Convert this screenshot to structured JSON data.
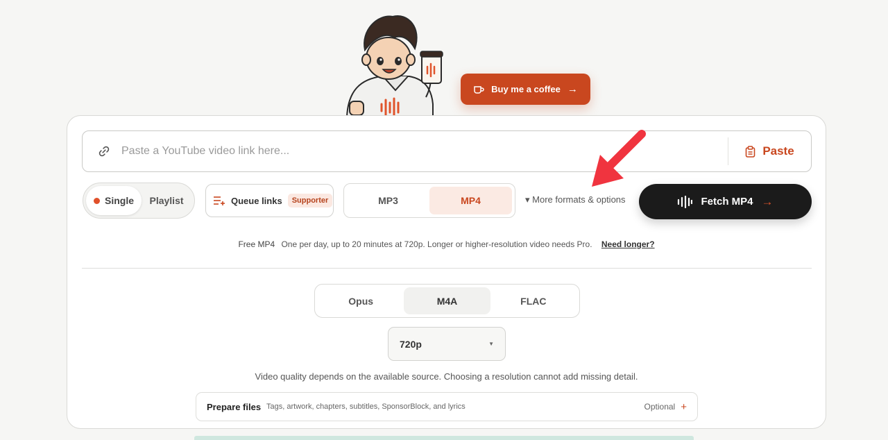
{
  "coffee_button": {
    "label": "Buy me a coffee",
    "arrow": "→",
    "icon": "coffee-cup-icon"
  },
  "url_bar": {
    "placeholder": "Paste a YouTube video link here...",
    "paste_label": "Paste"
  },
  "mode_toggle": {
    "single_label": "Single",
    "playlist_label": "Playlist",
    "selected": "Single"
  },
  "queue": {
    "label": "Queue links",
    "badge": "Supporter"
  },
  "format_toggle": {
    "mp3_label": "MP3",
    "mp4_label": "MP4",
    "selected": "MP4"
  },
  "more_formats_label": "▾ More formats & options",
  "fetch_button": {
    "label": "Fetch MP4",
    "arrow": "→"
  },
  "info": {
    "free_label": "Free MP4",
    "text": "One per day, up to 20 minutes at 720p. Longer or higher-resolution video needs Pro.",
    "need_longer": "Need longer?"
  },
  "audio_format": {
    "options": [
      "Opus",
      "M4A",
      "FLAC"
    ],
    "selected": "M4A"
  },
  "resolution": {
    "value": "720p",
    "caret": "▼"
  },
  "quality_note": "Video quality depends on the available source. Choosing a resolution cannot add missing detail.",
  "prepare_files": {
    "title": "Prepare files",
    "description": "Tags, artwork, chapters, subtitles, SponsorBlock, and lyrics",
    "optional_label": "Optional",
    "plus": "+"
  },
  "colors": {
    "accent": "#c9471f",
    "dark": "#1b1b1b",
    "annotation": "#f0343f"
  }
}
